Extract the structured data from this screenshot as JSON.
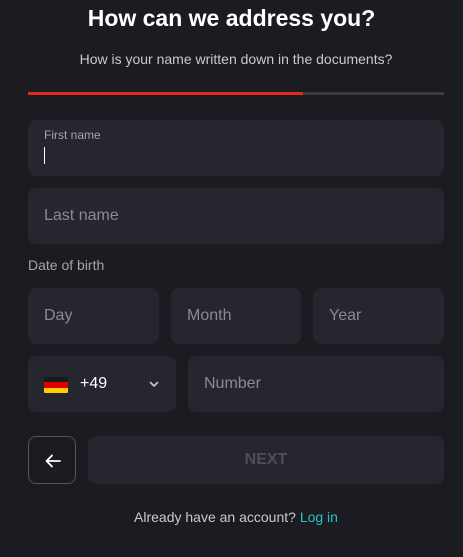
{
  "header": {
    "title": "How can we address you?",
    "subtitle": "How is your name written down in the documents?"
  },
  "progress": {
    "fraction": 0.66,
    "fill_color": "#e4281c",
    "track_color": "#3a3a42"
  },
  "form": {
    "first_name": {
      "label": "First name",
      "value": ""
    },
    "last_name": {
      "placeholder": "Last name",
      "value": ""
    },
    "dob": {
      "label": "Date of birth",
      "day_placeholder": "Day",
      "month_placeholder": "Month",
      "year_placeholder": "Year"
    },
    "phone": {
      "country_flag": "germany-flag-icon",
      "dial_code": "+49",
      "number_placeholder": "Number"
    }
  },
  "actions": {
    "back_icon": "arrow-left-icon",
    "next_label": "NEXT"
  },
  "footer": {
    "prompt": "Already have an account?",
    "login_label": "Log in",
    "link_color": "#1ec8c0"
  }
}
